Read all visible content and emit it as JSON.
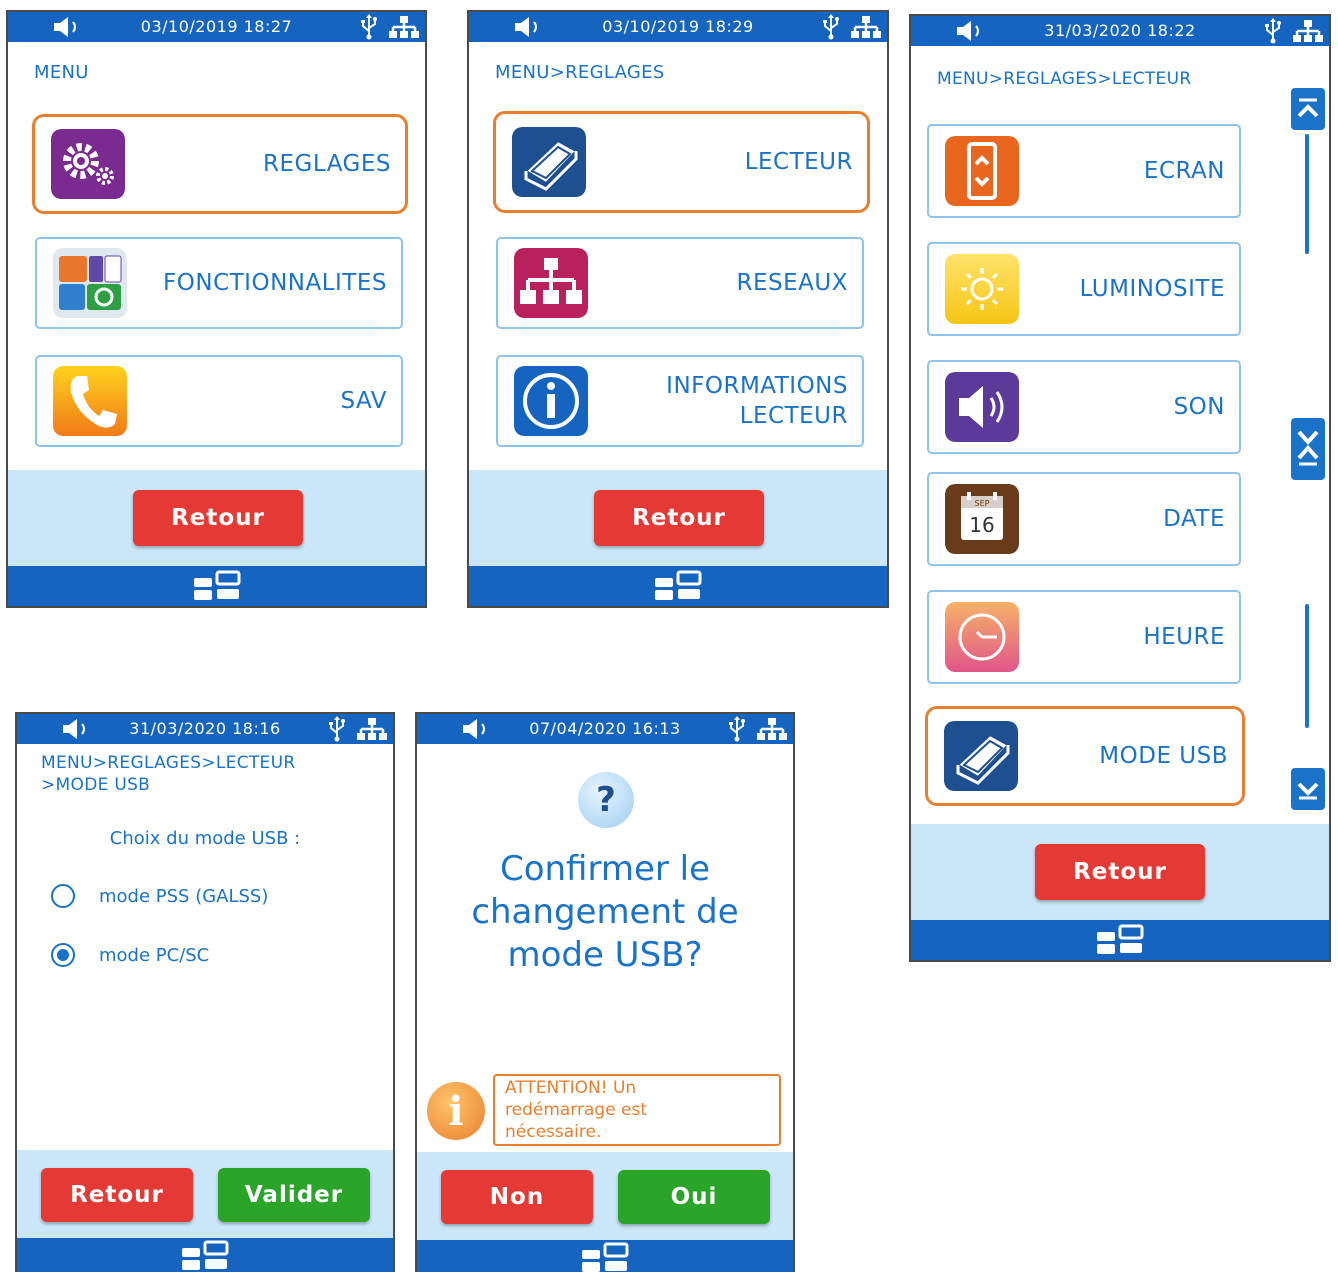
{
  "screens": {
    "menu": {
      "status": {
        "datetime": "03/10/2019 18:27"
      },
      "breadcrumb": "MENU",
      "items": [
        {
          "label": "REGLAGES",
          "icon": "gears-icon",
          "selected": true
        },
        {
          "label": "FONCTIONNALITES",
          "icon": "features-icon",
          "selected": false
        },
        {
          "label": "SAV",
          "icon": "phone-icon",
          "selected": false
        }
      ],
      "back_label": "Retour"
    },
    "reglages": {
      "status": {
        "datetime": "03/10/2019 18:29"
      },
      "breadcrumb": "MENU>REGLAGES",
      "items": [
        {
          "label": "LECTEUR",
          "icon": "card-reader-icon",
          "selected": true
        },
        {
          "label": "RESEAUX",
          "icon": "network-icon",
          "selected": false
        },
        {
          "label": "INFORMATIONS LECTEUR",
          "icon": "info-icon",
          "selected": false
        }
      ],
      "back_label": "Retour"
    },
    "lecteur": {
      "status": {
        "datetime": "31/03/2020 18:22"
      },
      "breadcrumb": "MENU>REGLAGES>LECTEUR",
      "items": [
        {
          "label": "ECRAN",
          "icon": "screen-icon",
          "selected": false
        },
        {
          "label": "LUMINOSITE",
          "icon": "sun-icon",
          "selected": false
        },
        {
          "label": "SON",
          "icon": "speaker-icon",
          "selected": false
        },
        {
          "label": "DATE",
          "icon": "calendar-icon",
          "selected": false,
          "calendar_month": "SEP",
          "calendar_day": "16"
        },
        {
          "label": "HEURE",
          "icon": "clock-icon",
          "selected": false
        },
        {
          "label": "MODE USB",
          "icon": "card-reader-icon",
          "selected": true
        }
      ],
      "back_label": "Retour"
    },
    "mode_usb": {
      "status": {
        "datetime": "31/03/2020 18:16"
      },
      "breadcrumb_line1": "MENU>REGLAGES>LECTEUR",
      "breadcrumb_line2": ">MODE USB",
      "prompt": "Choix du mode USB :",
      "options": [
        {
          "label": "mode PSS (GALSS)",
          "checked": false
        },
        {
          "label": "mode PC/SC",
          "checked": true
        }
      ],
      "back_label": "Retour",
      "validate_label": "Valider"
    },
    "confirm": {
      "status": {
        "datetime": "07/04/2020 16:13"
      },
      "question_mark": "?",
      "message_line1": "Confirmer le",
      "message_line2": "changement de",
      "message_line3": "mode USB?",
      "warning_line1": "ATTENTION! Un",
      "warning_line2": "redémarrage est",
      "warning_line3": "nécessaire.",
      "info_glyph": "i",
      "no_label": "Non",
      "yes_label": "Oui"
    }
  },
  "colors": {
    "status_bar": "#1565c0",
    "text_blue": "#1a73c9",
    "footer_bg": "#cbe6f8",
    "selected_border": "#e87f2e",
    "button_red": "#e53935",
    "button_green": "#2aa52a",
    "warning_orange": "#e87f2e"
  }
}
